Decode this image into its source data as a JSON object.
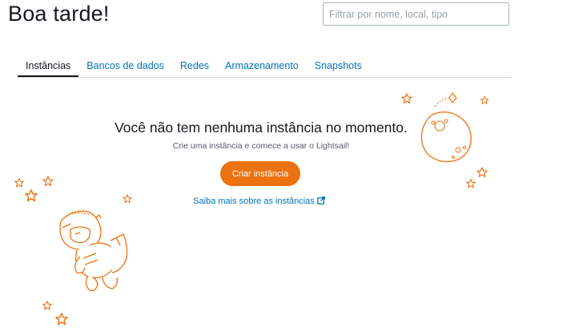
{
  "header": {
    "greeting": "Boa tarde!",
    "search_placeholder": "Filtrar por nome, local, tipo"
  },
  "tabs": [
    {
      "label": "Instâncias",
      "active": true
    },
    {
      "label": "Bancos de dados",
      "active": false
    },
    {
      "label": "Redes",
      "active": false
    },
    {
      "label": "Armazenamento",
      "active": false
    },
    {
      "label": "Snapshots",
      "active": false
    }
  ],
  "empty_state": {
    "title": "Você não tem nenhuma instância no momento.",
    "subtitle": "Crie uma instância e comece a usar o Lightsail!",
    "create_button": "Criar instância",
    "learn_more": "Saiba mais sobre as instâncias",
    "learn_more_icon": "external-link-icon"
  },
  "colors": {
    "accent": "#ec7211",
    "link": "#0073bb",
    "text": "#16191f"
  },
  "illustration": {
    "robot_icon": "robot-illustration",
    "moon_icon": "moon-illustration",
    "star_icon": "star-icon"
  }
}
